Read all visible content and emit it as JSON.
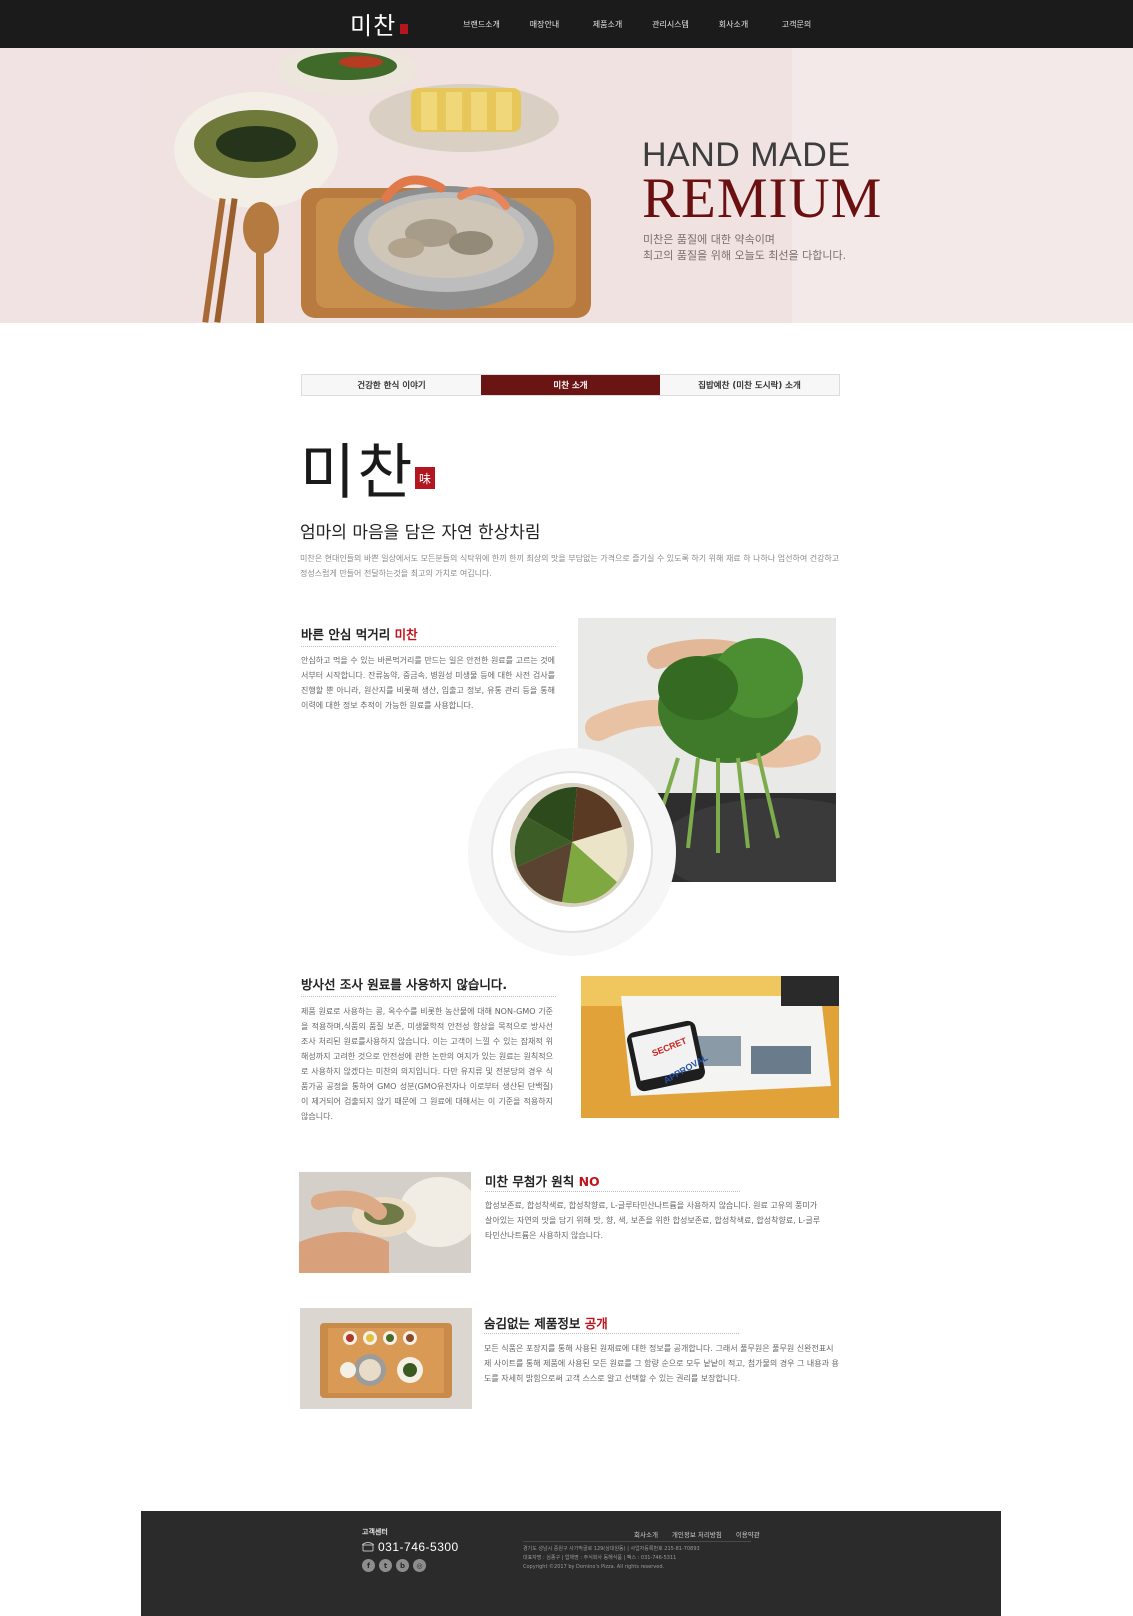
{
  "header": {
    "logo": "미찬",
    "nav": [
      "브랜드소개",
      "매장안내",
      "제품소개",
      "관리시스템",
      "회사소개",
      "고객문의"
    ]
  },
  "hero": {
    "title_line1": "HAND MADE",
    "title_line2": "REMIUM",
    "subtitle_line1": "미찬은 품질에 대한 약속이며",
    "subtitle_line2": "최고의 품질을 위해 오늘도 최선을 다합니다."
  },
  "tabs": [
    {
      "label": "건강한 한식 이야기",
      "active": false
    },
    {
      "label": "미찬 소개",
      "active": true
    },
    {
      "label": "집밥예찬 (미찬 도시락) 소개",
      "active": false
    }
  ],
  "brand": {
    "name": "미찬",
    "seal": "味",
    "tagline": "엄마의 마음을 담은 자연 한상차림",
    "intro": "미찬은 현대인들의 바쁜 일상에서도 모든분들의 식탁위에 한끼 한끼 최상의 맛을 부담없는 가격으로 즐기실 수 있도록 하기 위해 재료 하 나하나 엄선하여 건강하고 정성스럽게 만들어 전달하는것을 최고의 가치로 여깁니다."
  },
  "sections": [
    {
      "title": "바른 안심 먹거리 ",
      "accent": "미찬",
      "body": "안심하고 먹을 수 있는 바른먹거리를 만드는 일은 안전한 원료를 고르는 것에서부터 시작합니다. 잔류농약, 중금속, 병원성 미생물 등에 대한 사전 검사를 진행할 뿐 아니라, 원산지를 비롯해 생산, 입출고 정보, 유통 관리 등을 통해이력에 대한 정보 추적이 가능한 원료를 사용합니다."
    },
    {
      "title": "방사선 조사 원료를 사용하지 않습니다.",
      "accent": "",
      "body": "제품 원료로 사용하는 콩, 옥수수를 비롯한 농산물에 대해 NON-GMO 기준을 적용하며,식품의 품질 보존, 미생물학적 안전성 향상을 목적으로 방사선 조사 처리된 원료를사용하지 않습니다. 이는 고객이 느낄 수 있는 잠재적 위해성까지 고려한 것으로 안전성에 관한 논란의 여지가 있는 원료는 원칙적으로 사용하지 않겠다는 미찬의 의지입니다. 다만 유지류 및 전분당의 경우 식품가공 공정을 통하여 GMO 성분(GMO유전자나 이로부터 생산된 단백질)이 제거되어 검출되지 않기 때문에 그 원료에 대해서는 이 기준을 적용하지 않습니다."
    },
    {
      "title": "미찬 무첨가 원칙 ",
      "accent": "NO",
      "body": "합성보존료, 합성착색료, 합성착향료, L-글루타민산나트륨을 사용하지 않습니다. 원료 고유의 풍미가 살아있는 자연의 맛을 담기 위해 맛, 향, 색, 보존을 위한 합성보존료, 합성착색료, 합성착향료, L-글루타민산나트륨은 사용하지 않습니다."
    },
    {
      "title": "숨김없는 제품정보 ",
      "accent": "공개",
      "body": "모든 식품은 포장지를 통해 사용된 원재료에 대한 정보를 공개합니다. 그래서 풀무원은 풀무원 신완전표시제 사이트를 통해 제품에 사용된 모든 원료를 그 함량 순으로 모두 낱낱이 적고, 첨가물의 경우 그 내용과 용도를 자세히 밝힘으로써 고객 스스로 알고 선택할 수 있는 권리를 보장합니다."
    }
  ],
  "stamp_photo": {
    "stamp_top": "SECRET",
    "stamp_bottom": "APPROVAL"
  },
  "footer": {
    "cs_label": "고객센터",
    "phone": "031-746-5300",
    "links": [
      "회사소개",
      "개인정보 처리방침",
      "이용약관"
    ],
    "address_line1": "경기도 성남시 중원구 사기막골로 129(상대원동) | 사업자등록번호 215-81-70893",
    "address_line2": "대표자명 : 심종구 | 업체명 : 주식회사 동해식품 | 팩스 : 031-746-5311",
    "copyright": "Copyright ©2017 by Domino's Pizza. All rights reserved."
  },
  "colors": {
    "brand_dark_red": "#6b1414",
    "accent_red": "#c0141b",
    "nav_bg": "#1b1b1b",
    "footer_bg": "#2b2b2b"
  }
}
